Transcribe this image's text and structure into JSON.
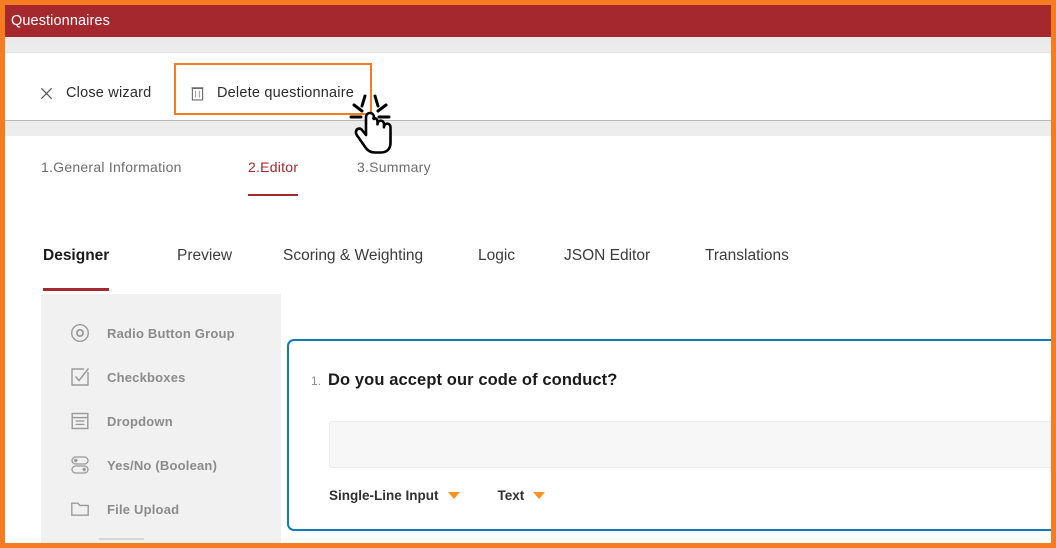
{
  "window": {
    "title": "Questionnaires",
    "header_color": "#A4282E",
    "highlight_color": "#F57C20"
  },
  "toolbar": {
    "close_wizard_label": "Close wizard",
    "close_wizard_icon": "close-icon",
    "delete_questionnaire_label": "Delete questionnaire",
    "delete_questionnaire_icon": "trash-icon"
  },
  "wizard_steps": [
    {
      "label": "1.General Information",
      "active": false
    },
    {
      "label": "2.Editor",
      "active": true
    },
    {
      "label": "3.Summary",
      "active": false
    }
  ],
  "editor_tabs": [
    {
      "label": "Designer",
      "active": true
    },
    {
      "label": "Preview",
      "active": false
    },
    {
      "label": "Scoring & Weighting",
      "active": false
    },
    {
      "label": "Logic",
      "active": false
    },
    {
      "label": "JSON Editor",
      "active": false
    },
    {
      "label": "Translations",
      "active": false
    }
  ],
  "palette": {
    "items": [
      {
        "label": "Radio Button Group",
        "icon": "radio-button-icon"
      },
      {
        "label": "Checkboxes",
        "icon": "checkbox-icon"
      },
      {
        "label": "Dropdown",
        "icon": "dropdown-icon"
      },
      {
        "label": "Yes/No (Boolean)",
        "icon": "toggle-icon"
      },
      {
        "label": "File Upload",
        "icon": "folder-icon"
      }
    ]
  },
  "question_card": {
    "number": "1.",
    "text": "Do you accept our code of conduct?",
    "answer_value": "",
    "answer_placeholder": "",
    "border_color": "#0F7CB5",
    "input_type_select": {
      "value": "Single-Line Input",
      "caret_icon": "chevron-down-icon",
      "caret_color": "#F79420"
    },
    "data_type_select": {
      "value": "Text",
      "caret_icon": "chevron-down-icon",
      "caret_color": "#F79420"
    }
  },
  "cursor": {
    "icon": "click-hand-cursor",
    "target": "Delete questionnaire"
  }
}
